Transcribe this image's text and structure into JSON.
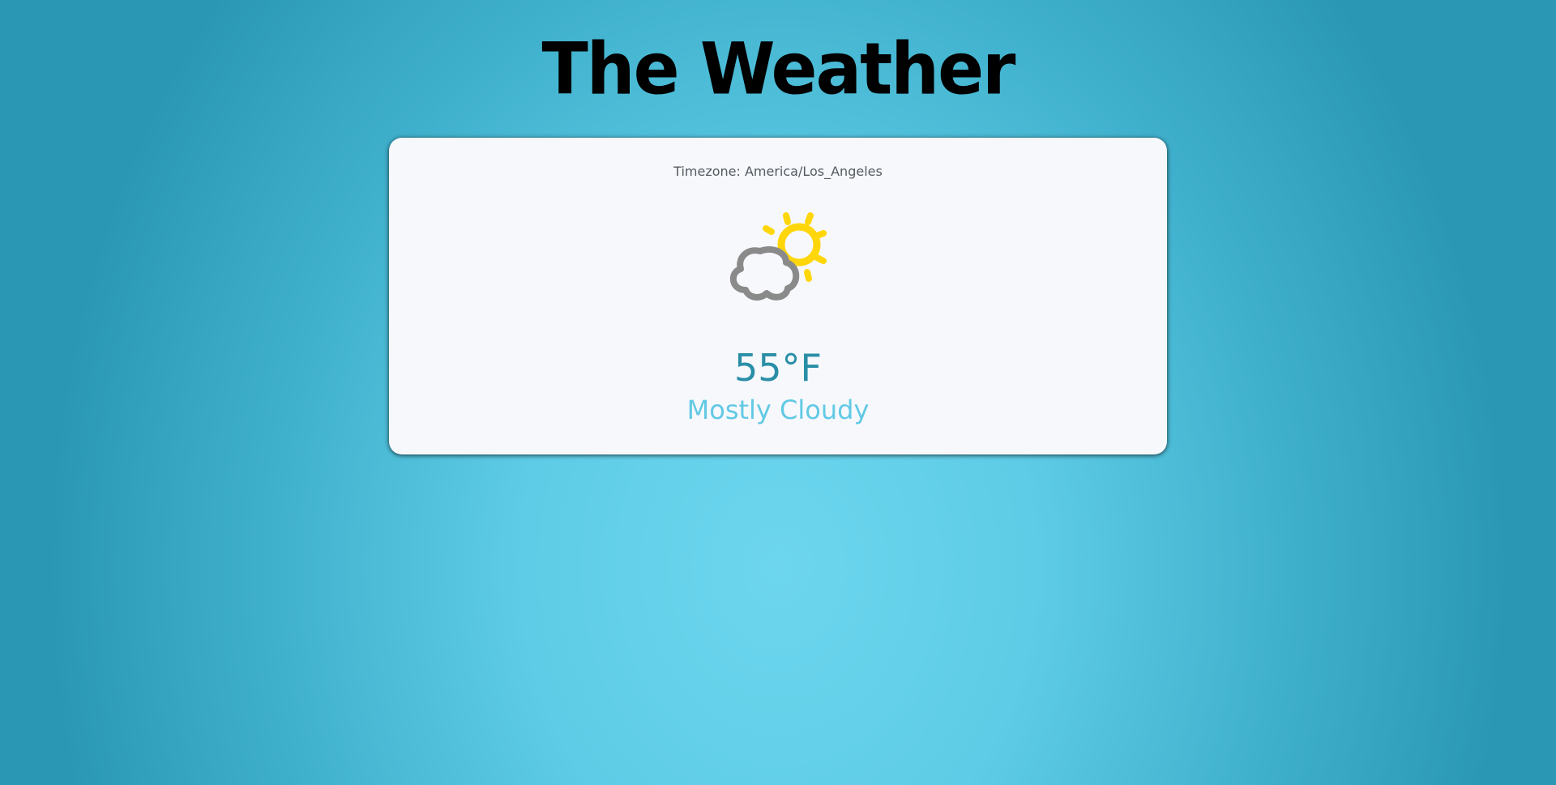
{
  "header": {
    "title": "The Weather"
  },
  "weather_card": {
    "timezone": "Timezone: America/Los_Angeles",
    "icon": "partly-cloudy-icon",
    "temperature": "55°F",
    "condition": "Mostly Cloudy"
  },
  "colors": {
    "sun": "#ffd60a",
    "cloud": "#8a8a8a",
    "temperature": "#2a8ea6",
    "condition": "#62c9e4"
  }
}
